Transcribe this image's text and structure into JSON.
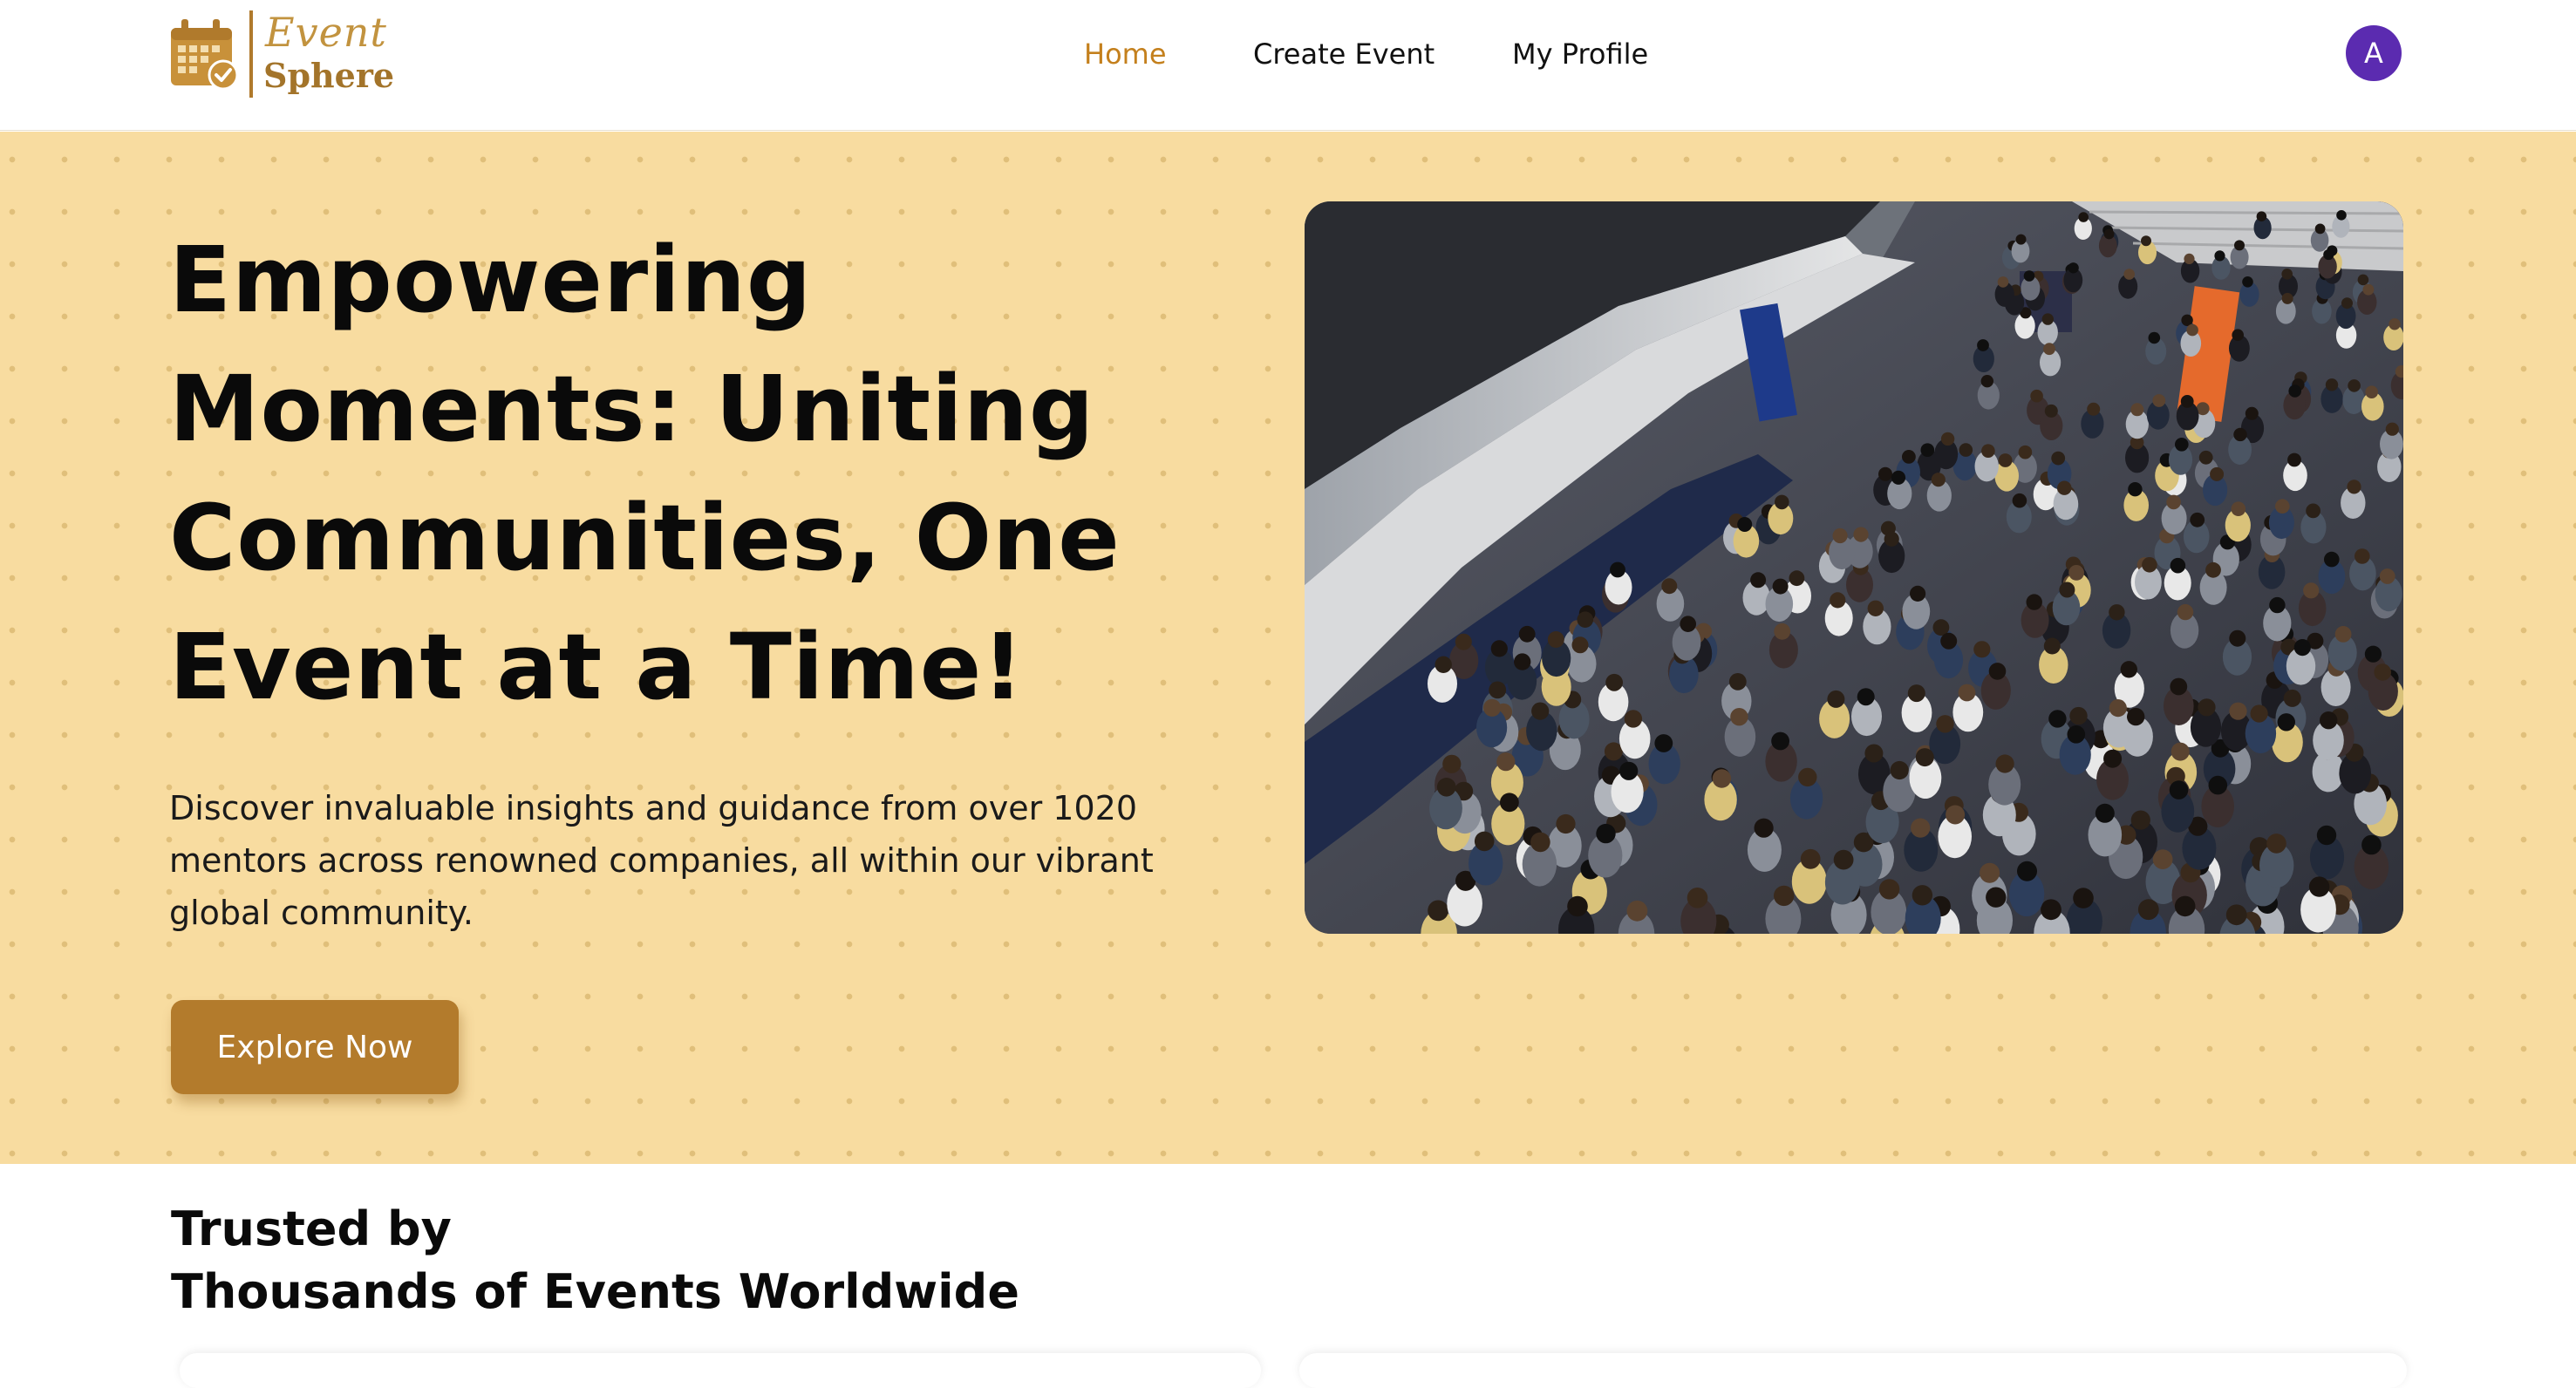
{
  "brand": {
    "name_top": "Event",
    "name_bottom": "Sphere",
    "icon": "calendar-check-icon",
    "colors": {
      "gold": "#c2933f",
      "dark_gold": "#a3742a"
    }
  },
  "nav": {
    "items": [
      {
        "label": "Home",
        "active": true
      },
      {
        "label": "Create Event",
        "active": false
      },
      {
        "label": "My Profile",
        "active": false
      }
    ],
    "active_color": "#c4801d"
  },
  "user": {
    "avatar_initial": "A",
    "avatar_color": "#5b2bb0"
  },
  "hero": {
    "title": "Empowering Moments: Uniting Communities, One Event at a Time!",
    "description": "Discover invaluable insights and guidance from over 1020 mentors across renowned companies, all within our vibrant global community.",
    "cta_label": "Explore Now",
    "image_subject": "crowd-at-conference-photo",
    "background_color": "#f8dca0",
    "button_color": "#b37b2c"
  },
  "trusted": {
    "title_line1": "Trusted by",
    "title_line2": "Thousands of Events Worldwide"
  }
}
